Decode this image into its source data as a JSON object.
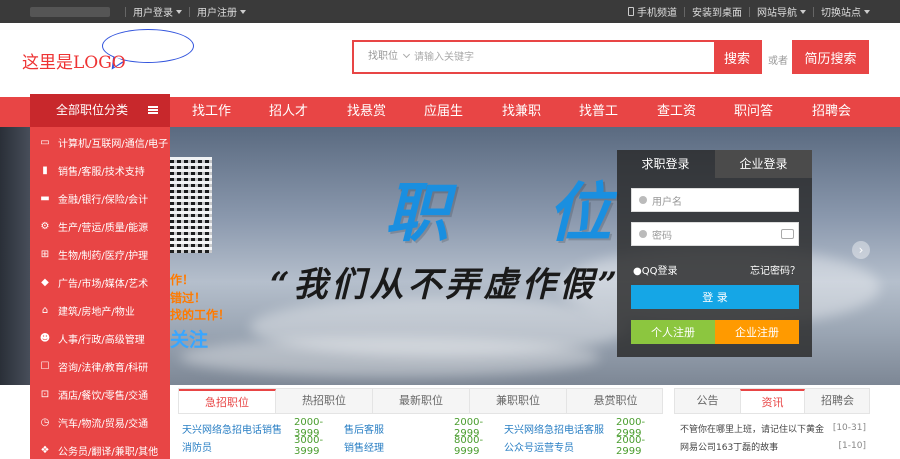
{
  "topbar": {
    "left_links": [
      {
        "label": "用户登录"
      },
      {
        "label": "用户注册"
      }
    ],
    "right_links": [
      {
        "label": "手机频道"
      },
      {
        "label": "安装到桌面"
      },
      {
        "label": "网站导航"
      },
      {
        "label": "切换站点"
      }
    ]
  },
  "header": {
    "logo_text": "这里是LOGO",
    "search_category": "找职位",
    "search_placeholder": "请输入关键字",
    "search_button": "搜索",
    "or_text": "或者",
    "resume_search_button": "简历搜索"
  },
  "nav": {
    "category_title": "全部职位分类",
    "items": [
      "找工作",
      "招人才",
      "找悬赏",
      "应届生",
      "找兼职",
      "找普工",
      "查工资",
      "职问答",
      "招聘会"
    ]
  },
  "sidebar": {
    "items": [
      {
        "label": "计算机/互联网/通信/电子",
        "icon": "monitor-icon"
      },
      {
        "label": "销售/客服/技术支持",
        "icon": "bar-chart-icon"
      },
      {
        "label": "金融/银行/保险/会计",
        "icon": "card-icon"
      },
      {
        "label": "生产/营运/质量/能源",
        "icon": "gear-icon"
      },
      {
        "label": "生物/制药/医疗/护理",
        "icon": "plus-icon"
      },
      {
        "label": "广告/市场/媒体/艺术",
        "icon": "tag-icon"
      },
      {
        "label": "建筑/房地产/物业",
        "icon": "building-icon"
      },
      {
        "label": "人事/行政/高级管理",
        "icon": "users-icon"
      },
      {
        "label": "咨询/法律/教育/科研",
        "icon": "chat-icon"
      },
      {
        "label": "酒店/餐饮/零售/交通",
        "icon": "cart-icon"
      },
      {
        "label": "汽车/物流/贸易/交通",
        "icon": "clock-icon"
      },
      {
        "label": "公务员/翻译/兼职/其他",
        "icon": "dropbox-icon"
      }
    ]
  },
  "banner": {
    "title": "职 位",
    "subtitle": "“我们从不弄虚作假”",
    "promo_lines": [
      "作！",
      "错过！",
      "找的工作！",
      "关注"
    ]
  },
  "login": {
    "tab_job_seeker": "求职登录",
    "tab_company": "企业登录",
    "username_placeholder": "用户名",
    "password_placeholder": "密码",
    "qq_login": "QQ登录",
    "forgot_password": "忘记密码？",
    "login_button": "登 录",
    "personal_register": "个人注册",
    "company_register": "企业注册"
  },
  "jobs": {
    "tabs": [
      "急招职位",
      "热招职位",
      "最新职位",
      "兼职职位",
      "悬赏职位"
    ],
    "rows": [
      {
        "name1": "天兴网络急招电话销售",
        "salary1": "2000-3999",
        "name2": "售后客服",
        "salary2": "2000-2999",
        "name3": "天兴网络急招电话客服",
        "salary3": "2000-2999"
      },
      {
        "name1": "消防员",
        "salary1": "3000-3999",
        "name2": "销售经理",
        "salary2": "8000-9999",
        "name3": "公众号运营专员",
        "salary3": "2000-2999"
      }
    ]
  },
  "notice": {
    "tabs": [
      "公告",
      "资讯",
      "招聘会"
    ],
    "rows": [
      {
        "text": "不管你在哪里上班，请记住以下黄金",
        "date": "[10-31]"
      },
      {
        "text": "网易公司163丁磊的故事",
        "date": "[1-10]"
      }
    ]
  }
}
